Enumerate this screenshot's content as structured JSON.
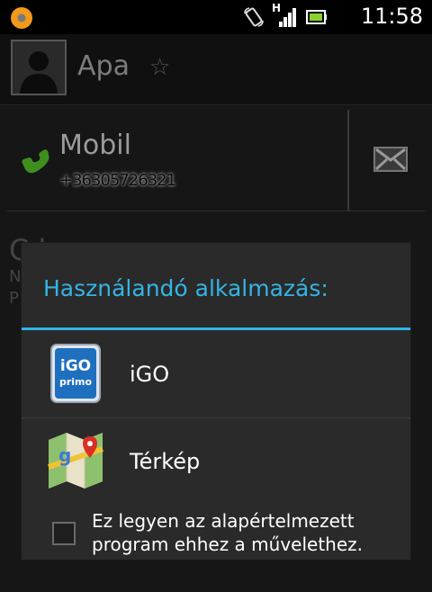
{
  "status_bar": {
    "time": "11:58",
    "signal_type": "H",
    "icons": [
      "app-notification-icon",
      "rotate-icon",
      "signal-icon",
      "battery-icon"
    ]
  },
  "contact": {
    "name": "Apa",
    "phone_label": "Mobil",
    "phone_number": "+36305726321"
  },
  "background_partial_text": {
    "line1": "C      k",
    "line2": "N",
    "line3": "P"
  },
  "dialog": {
    "title": "Használandó alkalmazás:",
    "apps": [
      {
        "label": "iGO",
        "icon": "igo-primo-icon"
      },
      {
        "label": "Térkép",
        "icon": "google-maps-icon"
      }
    ],
    "default_checkbox": {
      "checked": false,
      "label": "Ez legyen az alapértelmezett program ehhez a művelethez."
    }
  },
  "colors": {
    "accent": "#33b5e5",
    "dialog_bg": "#2a2a2a",
    "phone_green": "#3f8f1e"
  }
}
